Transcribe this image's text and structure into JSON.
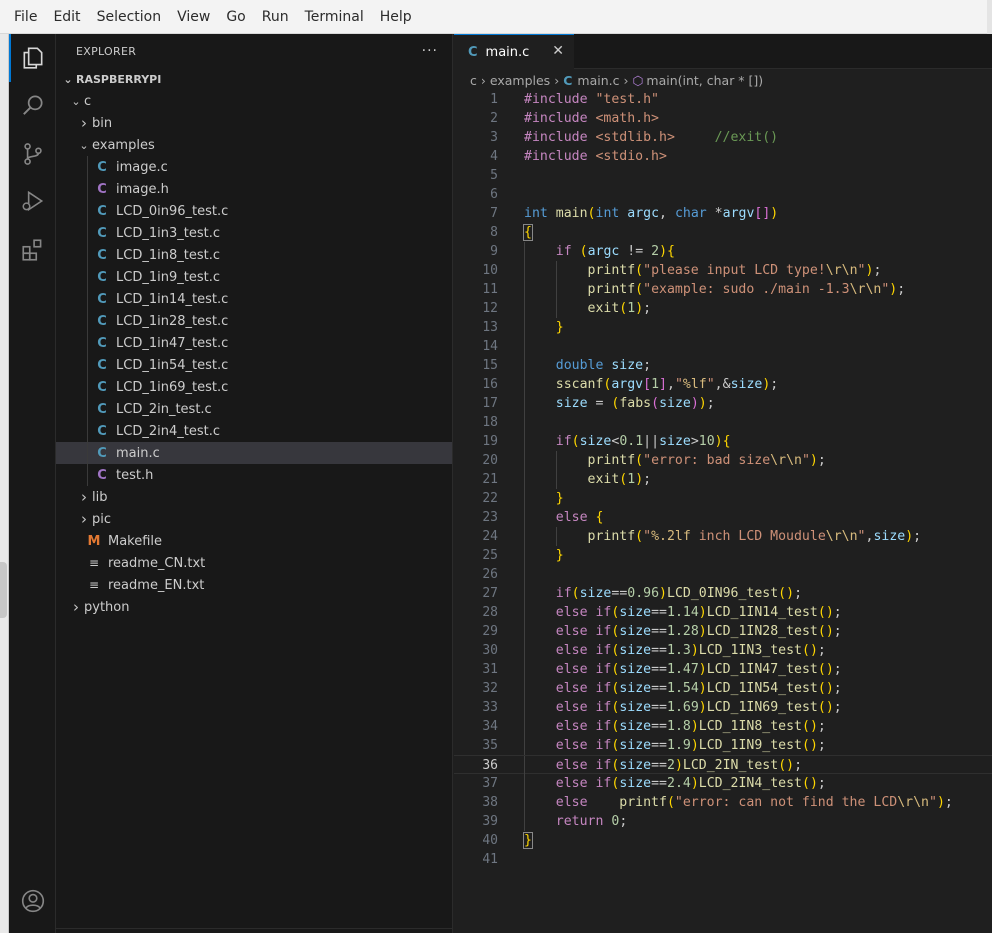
{
  "menu": [
    "File",
    "Edit",
    "Selection",
    "View",
    "Go",
    "Run",
    "Terminal",
    "Help"
  ],
  "activity": [
    "explorer",
    "search",
    "source-control",
    "run-debug",
    "extensions",
    "account"
  ],
  "sidebar": {
    "title": "EXPLORER",
    "more": "···",
    "root": "RASPBERRYPI",
    "tree": [
      {
        "depth": 1,
        "chev": "v",
        "label": "c",
        "icon": ""
      },
      {
        "depth": 2,
        "chev": ">",
        "label": "bin",
        "icon": ""
      },
      {
        "depth": 2,
        "chev": "v",
        "label": "examples",
        "icon": ""
      },
      {
        "depth": 3,
        "chev": "",
        "label": "image.c",
        "icon": "C"
      },
      {
        "depth": 3,
        "chev": "",
        "label": "image.h",
        "icon": "C"
      },
      {
        "depth": 3,
        "chev": "",
        "label": "LCD_0in96_test.c",
        "icon": "C"
      },
      {
        "depth": 3,
        "chev": "",
        "label": "LCD_1in3_test.c",
        "icon": "C"
      },
      {
        "depth": 3,
        "chev": "",
        "label": "LCD_1in8_test.c",
        "icon": "C"
      },
      {
        "depth": 3,
        "chev": "",
        "label": "LCD_1in9_test.c",
        "icon": "C"
      },
      {
        "depth": 3,
        "chev": "",
        "label": "LCD_1in14_test.c",
        "icon": "C"
      },
      {
        "depth": 3,
        "chev": "",
        "label": "LCD_1in28_test.c",
        "icon": "C"
      },
      {
        "depth": 3,
        "chev": "",
        "label": "LCD_1in47_test.c",
        "icon": "C"
      },
      {
        "depth": 3,
        "chev": "",
        "label": "LCD_1in54_test.c",
        "icon": "C"
      },
      {
        "depth": 3,
        "chev": "",
        "label": "LCD_1in69_test.c",
        "icon": "C"
      },
      {
        "depth": 3,
        "chev": "",
        "label": "LCD_2in_test.c",
        "icon": "C"
      },
      {
        "depth": 3,
        "chev": "",
        "label": "LCD_2in4_test.c",
        "icon": "C"
      },
      {
        "depth": 3,
        "chev": "",
        "label": "main.c",
        "icon": "C",
        "selected": true
      },
      {
        "depth": 3,
        "chev": "",
        "label": "test.h",
        "icon": "C"
      },
      {
        "depth": 2,
        "chev": ">",
        "label": "lib",
        "icon": ""
      },
      {
        "depth": 2,
        "chev": ">",
        "label": "pic",
        "icon": ""
      },
      {
        "depth": 2,
        "chev": "",
        "label": "Makefile",
        "icon": "M"
      },
      {
        "depth": 2,
        "chev": "",
        "label": "readme_CN.txt",
        "icon": "≡"
      },
      {
        "depth": 2,
        "chev": "",
        "label": "readme_EN.txt",
        "icon": "≡"
      },
      {
        "depth": 1,
        "chev": ">",
        "label": "python",
        "icon": ""
      }
    ]
  },
  "editor": {
    "tab": {
      "icon": "C",
      "label": "main.c",
      "close": "✕"
    },
    "breadcrumbs": [
      "c",
      "examples",
      "main.c",
      "main(int, char * [])"
    ],
    "current_line": 36,
    "lines": [
      "#include \"test.h\"",
      "#include <math.h>",
      "#include <stdlib.h>     //exit()",
      "#include <stdio.h>",
      "",
      "",
      "int main(int argc, char *argv[])",
      "{",
      "    if (argc != 2){",
      "        printf(\"please input LCD type!\\r\\n\");",
      "        printf(\"example: sudo ./main -1.3\\r\\n\");",
      "        exit(1);",
      "    }",
      "",
      "    double size;",
      "    sscanf(argv[1],\"%lf\",&size);",
      "    size = (fabs(size));",
      "",
      "    if(size<0.1||size>10){",
      "        printf(\"error: bad size\\r\\n\");",
      "        exit(1);",
      "    }",
      "    else {",
      "        printf(\"%.2lf inch LCD Moudule\\r\\n\",size);",
      "    }",
      "",
      "    if(size==0.96)LCD_0IN96_test();",
      "    else if(size==1.14)LCD_1IN14_test();",
      "    else if(size==1.28)LCD_1IN28_test();",
      "    else if(size==1.3)LCD_1IN3_test();",
      "    else if(size==1.47)LCD_1IN47_test();",
      "    else if(size==1.54)LCD_1IN54_test();",
      "    else if(size==1.69)LCD_1IN69_test();",
      "    else if(size==1.8)LCD_1IN8_test();",
      "    else if(size==1.9)LCD_1IN9_test();",
      "    else if(size==2)LCD_2IN_test();",
      "    else if(size==2.4)LCD_2IN4_test();",
      "    else    printf(\"error: can not find the LCD\\r\\n\");",
      "    return 0;",
      "}",
      ""
    ]
  },
  "colors": {
    "accent": "#0078d4",
    "keyword": "#c586c0",
    "type": "#569cd6",
    "function": "#dcdcaa",
    "variable": "#9cdcfe",
    "string": "#ce9178",
    "number": "#b5cea8",
    "comment": "#6a9955"
  }
}
